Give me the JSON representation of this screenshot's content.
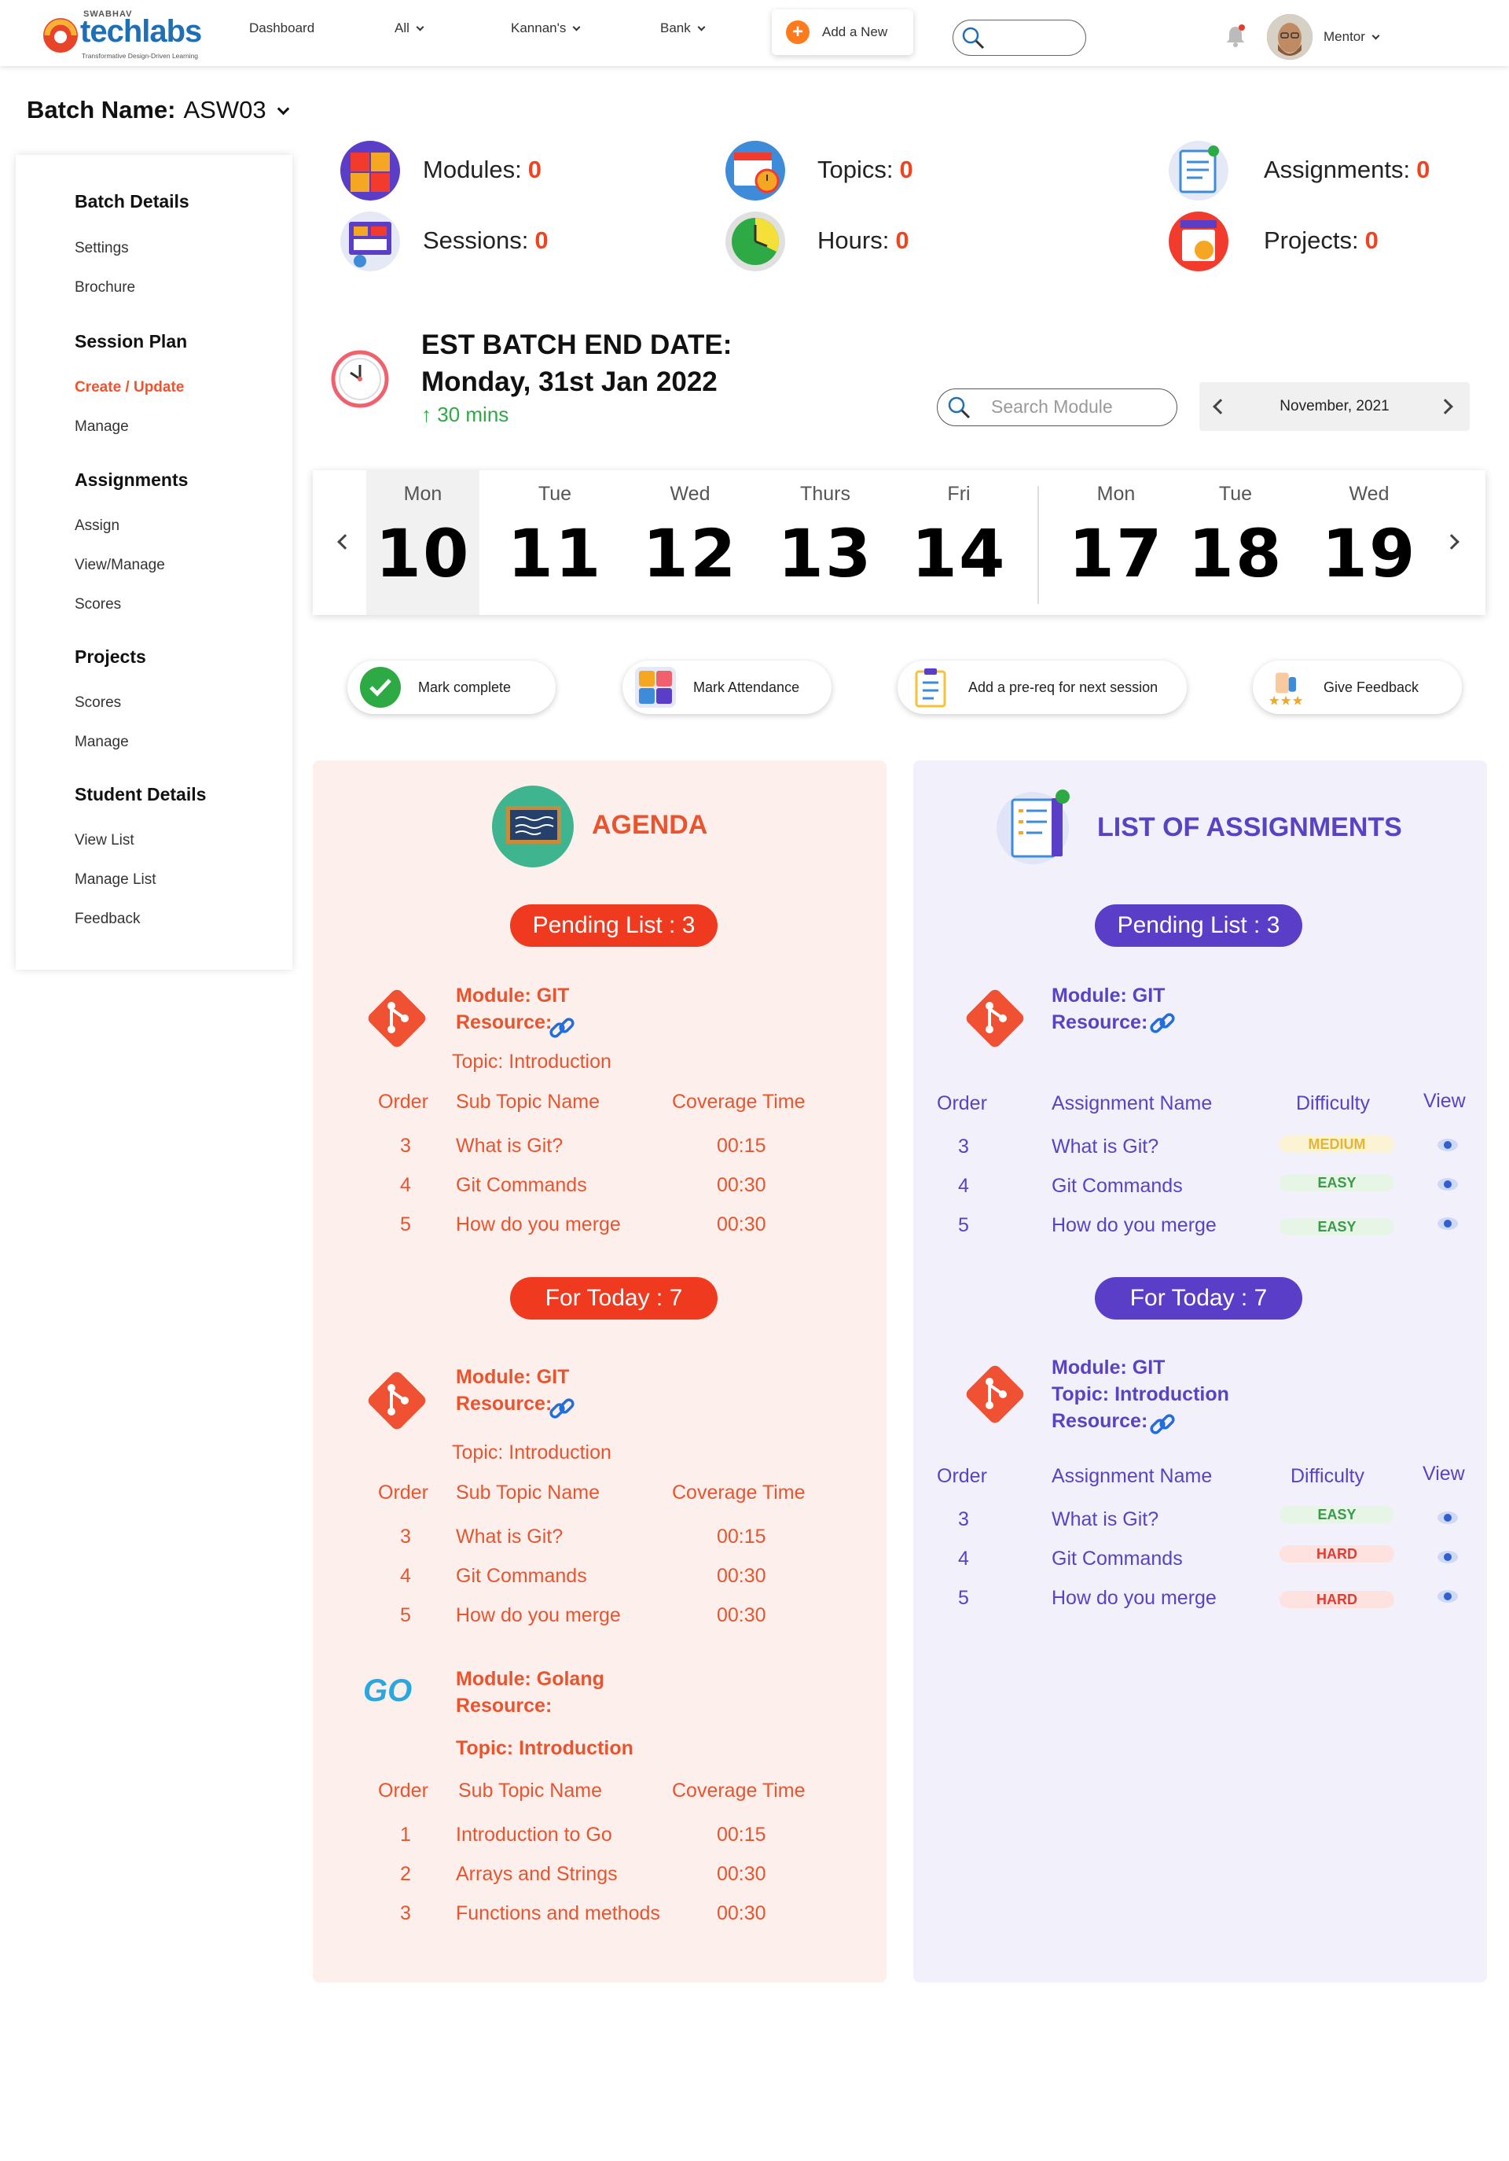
{
  "brand": {
    "top_text": "SWABHAV",
    "name": "techlabs",
    "tagline": "Transformative Design-Driven Learning"
  },
  "nav": {
    "dashboard": "Dashboard",
    "all": "All",
    "kannans": "Kannan's",
    "bank": "Bank",
    "add_new": "Add a New",
    "user": "Mentor"
  },
  "batch": {
    "label": "Batch Name:",
    "value": "ASW03"
  },
  "sidebar": {
    "batch_details": "Batch Details",
    "settings": "Settings",
    "brochure": "Brochure",
    "session_plan": "Session Plan",
    "create_update": "Create / Update",
    "manage1": "Manage",
    "assignments": "Assignments",
    "assign": "Assign",
    "view_manage": "View/Manage",
    "scores1": "Scores",
    "projects": "Projects",
    "scores2": "Scores",
    "manage2": "Manage",
    "student_details": "Student Details",
    "view_list": "View List",
    "manage_list": "Manage List",
    "feedback": "Feedback"
  },
  "stats": {
    "modules": {
      "label": "Modules:",
      "value": "0"
    },
    "topics": {
      "label": "Topics:",
      "value": "0"
    },
    "assignments": {
      "label": "Assignments:",
      "value": "0"
    },
    "sessions": {
      "label": "Sessions:",
      "value": "0"
    },
    "hours": {
      "label": "Hours:",
      "value": "0"
    },
    "projects": {
      "label": "Projects:",
      "value": "0"
    }
  },
  "end_date": {
    "line1": "EST BATCH END DATE:",
    "line2": "Monday, 31st Jan 2022",
    "delta": "30 mins"
  },
  "search_module": {
    "placeholder": "Search Module"
  },
  "month": "November, 2021",
  "calendar": [
    {
      "name": "Mon",
      "date": "10"
    },
    {
      "name": "Tue",
      "date": "11"
    },
    {
      "name": "Wed",
      "date": "12"
    },
    {
      "name": "Thurs",
      "date": "13"
    },
    {
      "name": "Fri",
      "date": "14"
    },
    {
      "name": "Mon",
      "date": "17"
    },
    {
      "name": "Tue",
      "date": "18"
    },
    {
      "name": "Wed",
      "date": "19"
    }
  ],
  "actions": {
    "mark_complete": "Mark complete",
    "mark_attendance": "Mark Attendance",
    "prereq": "Add a pre-req for next session",
    "feedback": "Give Feedback"
  },
  "agenda": {
    "title": "AGENDA",
    "pending": "Pending List : 3",
    "today": "For Today : 7",
    "blocks": [
      {
        "module": "Module: GIT",
        "resource": "Resource:",
        "topic": "Topic: Introduction",
        "headers": [
          "Order",
          "Sub Topic Name",
          "Coverage Time"
        ],
        "rows": [
          [
            "3",
            "What is Git?",
            "00:15"
          ],
          [
            "4",
            "Git Commands",
            "00:30"
          ],
          [
            "5",
            "How do you merge",
            "00:30"
          ]
        ]
      },
      {
        "module": "Module: GIT",
        "resource": "Resource:",
        "topic": "Topic: Introduction",
        "headers": [
          "Order",
          "Sub Topic Name",
          "Coverage Time"
        ],
        "rows": [
          [
            "3",
            "What is Git?",
            "00:15"
          ],
          [
            "4",
            "Git Commands",
            "00:30"
          ],
          [
            "5",
            "How do you merge",
            "00:30"
          ]
        ]
      },
      {
        "module": "Module: Golang",
        "resource": "Resource:",
        "topic": "Topic: Introduction",
        "headers": [
          "Order",
          "Sub Topic Name",
          "Coverage Time"
        ],
        "rows": [
          [
            "1",
            "Introduction to Go",
            "00:15"
          ],
          [
            "2",
            "Arrays and Strings",
            "00:30"
          ],
          [
            "3",
            "Functions and methods",
            "00:30"
          ]
        ]
      }
    ],
    "go_logo": "GO"
  },
  "assignments_list": {
    "title": "LIST OF ASSIGNMENTS",
    "pending": "Pending List : 3",
    "today": "For Today : 7",
    "blocks": [
      {
        "module": "Module: GIT",
        "resource": "Resource:",
        "headers": [
          "Order",
          "Assignment Name",
          "Difficulty",
          "View"
        ],
        "rows": [
          [
            "3",
            "What is Git?",
            "MEDIUM"
          ],
          [
            "4",
            "Git Commands",
            "EASY"
          ],
          [
            "5",
            "How do you merge",
            "EASY"
          ]
        ]
      },
      {
        "module": "Module: GIT",
        "topic": "Topic: Introduction",
        "resource": "Resource:",
        "headers": [
          "Order",
          "Assignment Name",
          "Difficulty",
          "View"
        ],
        "rows": [
          [
            "3",
            "What is Git?",
            "EASY"
          ],
          [
            "4",
            "Git Commands",
            "HARD"
          ],
          [
            "5",
            "How do you merge",
            "HARD"
          ]
        ]
      }
    ]
  }
}
